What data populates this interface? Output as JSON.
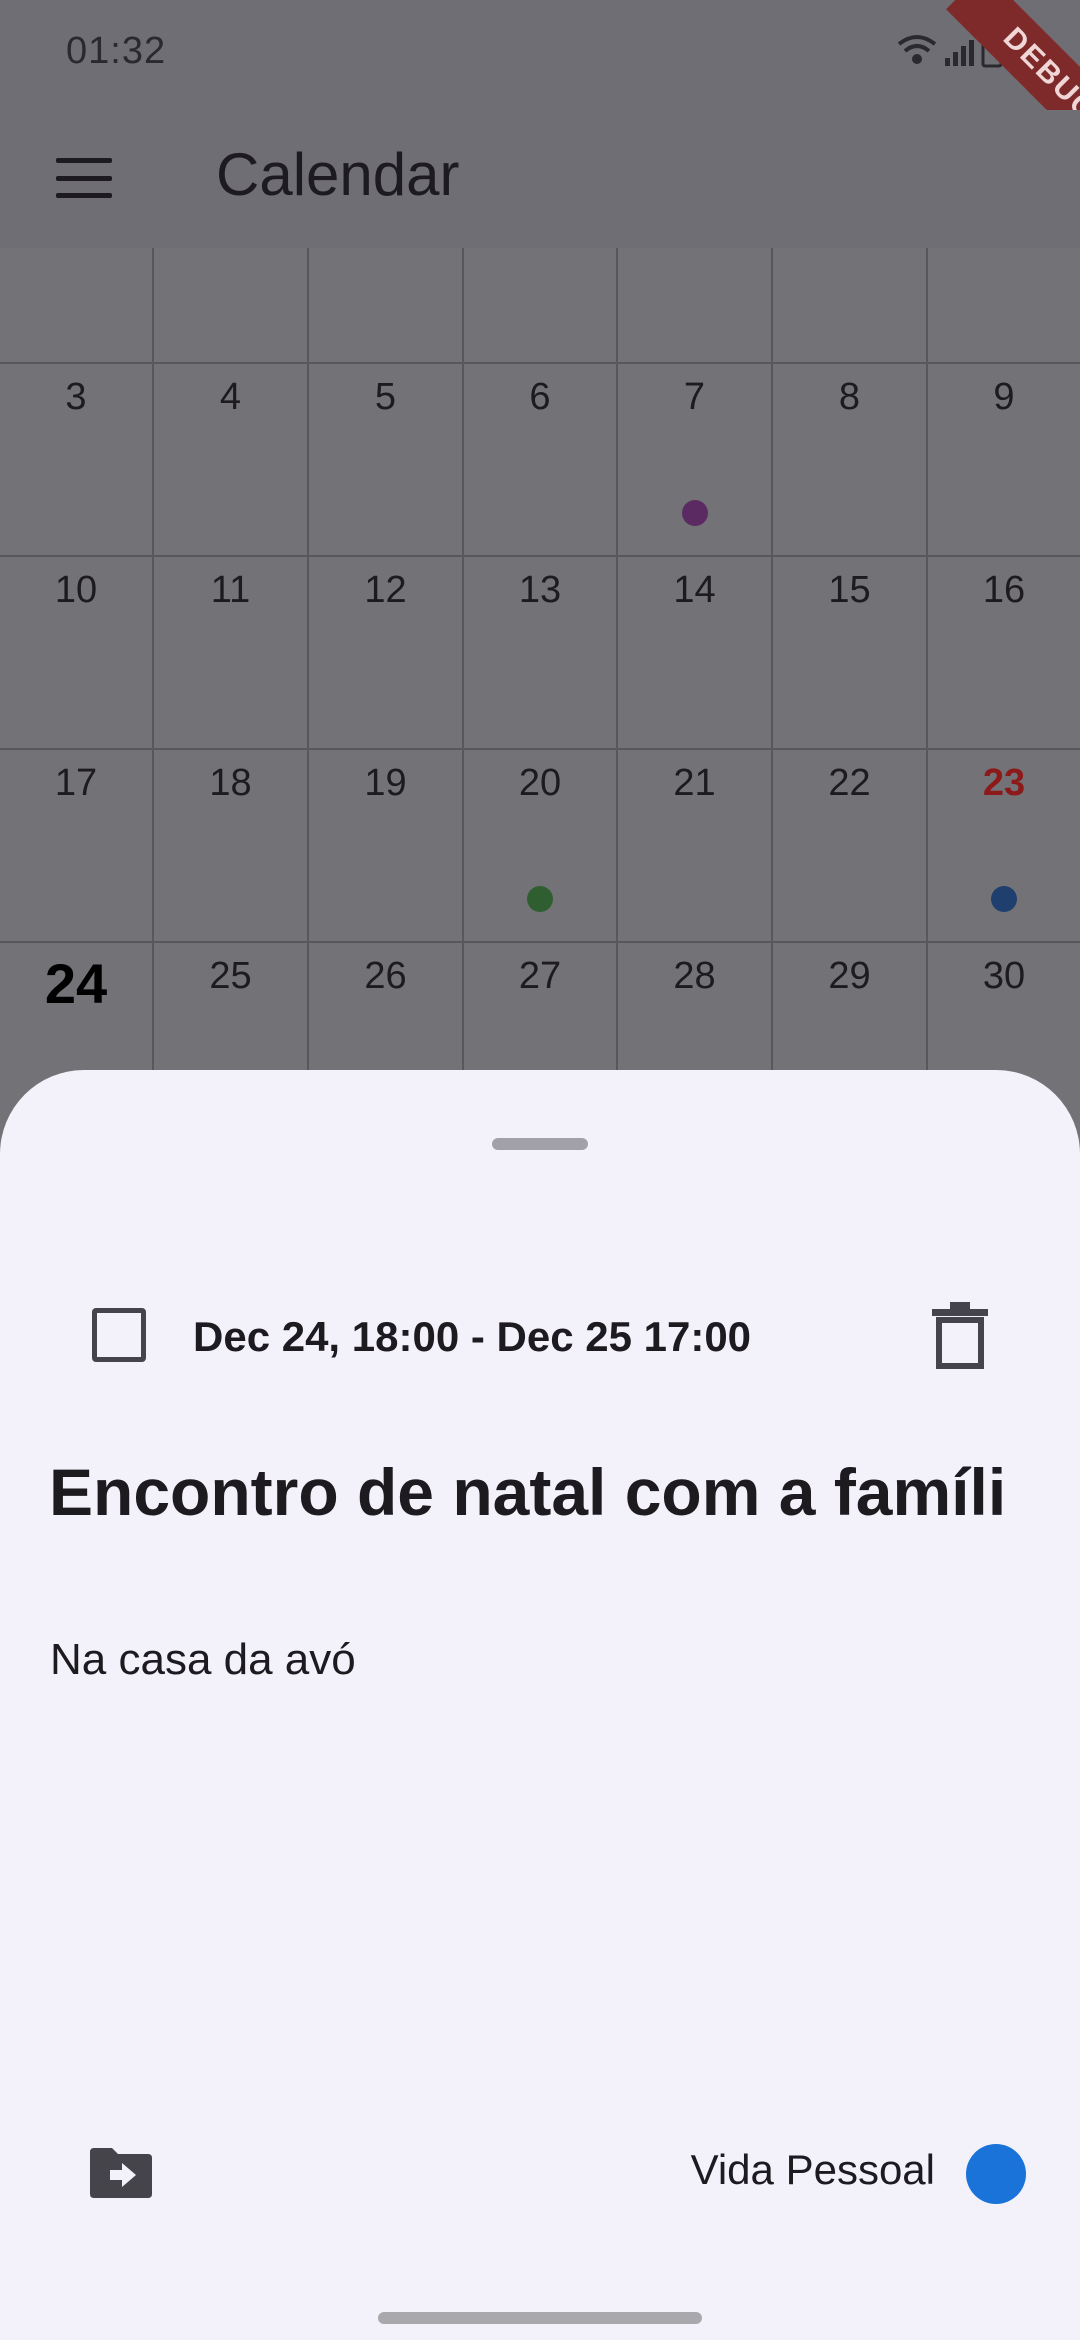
{
  "status_bar": {
    "time": "01:32",
    "icons": [
      "wifi-icon",
      "signal-icon",
      "battery-icon"
    ],
    "debug_banner": "DEBUG"
  },
  "app_bar": {
    "menu_icon": "menu-icon",
    "title": "Calendar"
  },
  "calendar": {
    "weeks": [
      [
        {
          "d": ""
        },
        {
          "d": ""
        },
        {
          "d": ""
        },
        {
          "d": ""
        },
        {
          "d": ""
        },
        {
          "d": ""
        },
        {
          "d": ""
        }
      ],
      [
        {
          "d": "3"
        },
        {
          "d": "4"
        },
        {
          "d": "5"
        },
        {
          "d": "6"
        },
        {
          "d": "7",
          "dots": [
            "#5b2a63"
          ]
        },
        {
          "d": "8"
        },
        {
          "d": "9"
        }
      ],
      [
        {
          "d": "10"
        },
        {
          "d": "11"
        },
        {
          "d": "12"
        },
        {
          "d": "13"
        },
        {
          "d": "14"
        },
        {
          "d": "15"
        },
        {
          "d": "16"
        }
      ],
      [
        {
          "d": "17"
        },
        {
          "d": "18"
        },
        {
          "d": "19"
        },
        {
          "d": "20",
          "dots": [
            "#2f5e30"
          ]
        },
        {
          "d": "21"
        },
        {
          "d": "22"
        },
        {
          "d": "23",
          "red": true,
          "dots": [
            "#1f3f6e"
          ]
        }
      ],
      [
        {
          "d": "24",
          "today": true
        },
        {
          "d": "25"
        },
        {
          "d": "26"
        },
        {
          "d": "27",
          "dots": [
            "#7a1e1e",
            "#1f3f6e"
          ]
        },
        {
          "d": "28",
          "dots": [
            "#7a1e1e",
            "#1f3f6e"
          ]
        },
        {
          "d": "29"
        },
        {
          "d": "30"
        }
      ]
    ]
  },
  "event_sheet": {
    "datetime": "Dec 24, 18:00 - Dec 25 17:00",
    "title": "Encontro de natal com a famíli",
    "description": "Na casa da avó",
    "calendar_name": "Vida Pessoal",
    "calendar_color": "#1a73d9",
    "checkbox_icon": "checkbox-outline-icon",
    "delete_icon": "trash-icon",
    "move_icon": "folder-move-icon"
  },
  "colors": {
    "scrim": "#6f6e74",
    "sheet_bg": "#f3f1f9",
    "weekend_red": "#8c1a1a"
  }
}
